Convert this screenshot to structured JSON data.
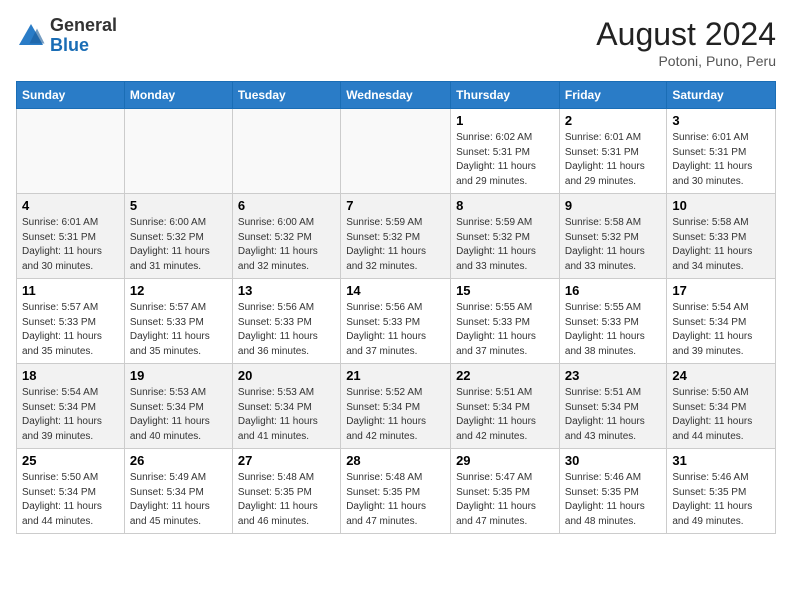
{
  "header": {
    "logo_general": "General",
    "logo_blue": "Blue",
    "month_year": "August 2024",
    "location": "Potoni, Puno, Peru"
  },
  "days_of_week": [
    "Sunday",
    "Monday",
    "Tuesday",
    "Wednesday",
    "Thursday",
    "Friday",
    "Saturday"
  ],
  "weeks": [
    [
      {
        "day": "",
        "info": ""
      },
      {
        "day": "",
        "info": ""
      },
      {
        "day": "",
        "info": ""
      },
      {
        "day": "",
        "info": ""
      },
      {
        "day": "1",
        "info": "Sunrise: 6:02 AM\nSunset: 5:31 PM\nDaylight: 11 hours\nand 29 minutes."
      },
      {
        "day": "2",
        "info": "Sunrise: 6:01 AM\nSunset: 5:31 PM\nDaylight: 11 hours\nand 29 minutes."
      },
      {
        "day": "3",
        "info": "Sunrise: 6:01 AM\nSunset: 5:31 PM\nDaylight: 11 hours\nand 30 minutes."
      }
    ],
    [
      {
        "day": "4",
        "info": "Sunrise: 6:01 AM\nSunset: 5:31 PM\nDaylight: 11 hours\nand 30 minutes."
      },
      {
        "day": "5",
        "info": "Sunrise: 6:00 AM\nSunset: 5:32 PM\nDaylight: 11 hours\nand 31 minutes."
      },
      {
        "day": "6",
        "info": "Sunrise: 6:00 AM\nSunset: 5:32 PM\nDaylight: 11 hours\nand 32 minutes."
      },
      {
        "day": "7",
        "info": "Sunrise: 5:59 AM\nSunset: 5:32 PM\nDaylight: 11 hours\nand 32 minutes."
      },
      {
        "day": "8",
        "info": "Sunrise: 5:59 AM\nSunset: 5:32 PM\nDaylight: 11 hours\nand 33 minutes."
      },
      {
        "day": "9",
        "info": "Sunrise: 5:58 AM\nSunset: 5:32 PM\nDaylight: 11 hours\nand 33 minutes."
      },
      {
        "day": "10",
        "info": "Sunrise: 5:58 AM\nSunset: 5:33 PM\nDaylight: 11 hours\nand 34 minutes."
      }
    ],
    [
      {
        "day": "11",
        "info": "Sunrise: 5:57 AM\nSunset: 5:33 PM\nDaylight: 11 hours\nand 35 minutes."
      },
      {
        "day": "12",
        "info": "Sunrise: 5:57 AM\nSunset: 5:33 PM\nDaylight: 11 hours\nand 35 minutes."
      },
      {
        "day": "13",
        "info": "Sunrise: 5:56 AM\nSunset: 5:33 PM\nDaylight: 11 hours\nand 36 minutes."
      },
      {
        "day": "14",
        "info": "Sunrise: 5:56 AM\nSunset: 5:33 PM\nDaylight: 11 hours\nand 37 minutes."
      },
      {
        "day": "15",
        "info": "Sunrise: 5:55 AM\nSunset: 5:33 PM\nDaylight: 11 hours\nand 37 minutes."
      },
      {
        "day": "16",
        "info": "Sunrise: 5:55 AM\nSunset: 5:33 PM\nDaylight: 11 hours\nand 38 minutes."
      },
      {
        "day": "17",
        "info": "Sunrise: 5:54 AM\nSunset: 5:34 PM\nDaylight: 11 hours\nand 39 minutes."
      }
    ],
    [
      {
        "day": "18",
        "info": "Sunrise: 5:54 AM\nSunset: 5:34 PM\nDaylight: 11 hours\nand 39 minutes."
      },
      {
        "day": "19",
        "info": "Sunrise: 5:53 AM\nSunset: 5:34 PM\nDaylight: 11 hours\nand 40 minutes."
      },
      {
        "day": "20",
        "info": "Sunrise: 5:53 AM\nSunset: 5:34 PM\nDaylight: 11 hours\nand 41 minutes."
      },
      {
        "day": "21",
        "info": "Sunrise: 5:52 AM\nSunset: 5:34 PM\nDaylight: 11 hours\nand 42 minutes."
      },
      {
        "day": "22",
        "info": "Sunrise: 5:51 AM\nSunset: 5:34 PM\nDaylight: 11 hours\nand 42 minutes."
      },
      {
        "day": "23",
        "info": "Sunrise: 5:51 AM\nSunset: 5:34 PM\nDaylight: 11 hours\nand 43 minutes."
      },
      {
        "day": "24",
        "info": "Sunrise: 5:50 AM\nSunset: 5:34 PM\nDaylight: 11 hours\nand 44 minutes."
      }
    ],
    [
      {
        "day": "25",
        "info": "Sunrise: 5:50 AM\nSunset: 5:34 PM\nDaylight: 11 hours\nand 44 minutes."
      },
      {
        "day": "26",
        "info": "Sunrise: 5:49 AM\nSunset: 5:34 PM\nDaylight: 11 hours\nand 45 minutes."
      },
      {
        "day": "27",
        "info": "Sunrise: 5:48 AM\nSunset: 5:35 PM\nDaylight: 11 hours\nand 46 minutes."
      },
      {
        "day": "28",
        "info": "Sunrise: 5:48 AM\nSunset: 5:35 PM\nDaylight: 11 hours\nand 47 minutes."
      },
      {
        "day": "29",
        "info": "Sunrise: 5:47 AM\nSunset: 5:35 PM\nDaylight: 11 hours\nand 47 minutes."
      },
      {
        "day": "30",
        "info": "Sunrise: 5:46 AM\nSunset: 5:35 PM\nDaylight: 11 hours\nand 48 minutes."
      },
      {
        "day": "31",
        "info": "Sunrise: 5:46 AM\nSunset: 5:35 PM\nDaylight: 11 hours\nand 49 minutes."
      }
    ]
  ]
}
